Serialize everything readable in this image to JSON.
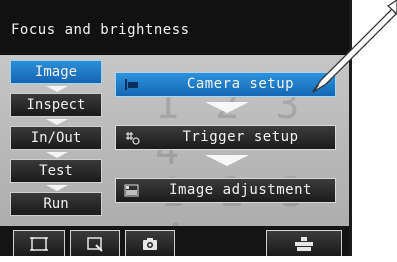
{
  "header": {
    "title": "Focus and brightness"
  },
  "sidebar": {
    "items": [
      {
        "label": "Image",
        "active": true
      },
      {
        "label": "Inspect",
        "active": false
      },
      {
        "label": "In/Out",
        "active": false
      },
      {
        "label": "Test",
        "active": false
      },
      {
        "label": "Run",
        "active": false
      }
    ]
  },
  "flow": {
    "steps": [
      {
        "label": "Camera setup",
        "icon": "camera-icon",
        "active": true
      },
      {
        "label": "Trigger setup",
        "icon": "trigger-icon",
        "active": false
      },
      {
        "label": "Image adjustment",
        "icon": "image-adjust-icon",
        "active": false
      }
    ]
  },
  "toolbar": {
    "buttons": [
      {
        "icon": "frame-icon"
      },
      {
        "icon": "zoom-icon"
      },
      {
        "icon": "camera-snapshot-icon"
      },
      {
        "icon": "tools-icon"
      }
    ]
  },
  "colors": {
    "accent": "#1f7fcf",
    "panel": "#1a1a1a",
    "arrow": "#f5f5f5"
  }
}
